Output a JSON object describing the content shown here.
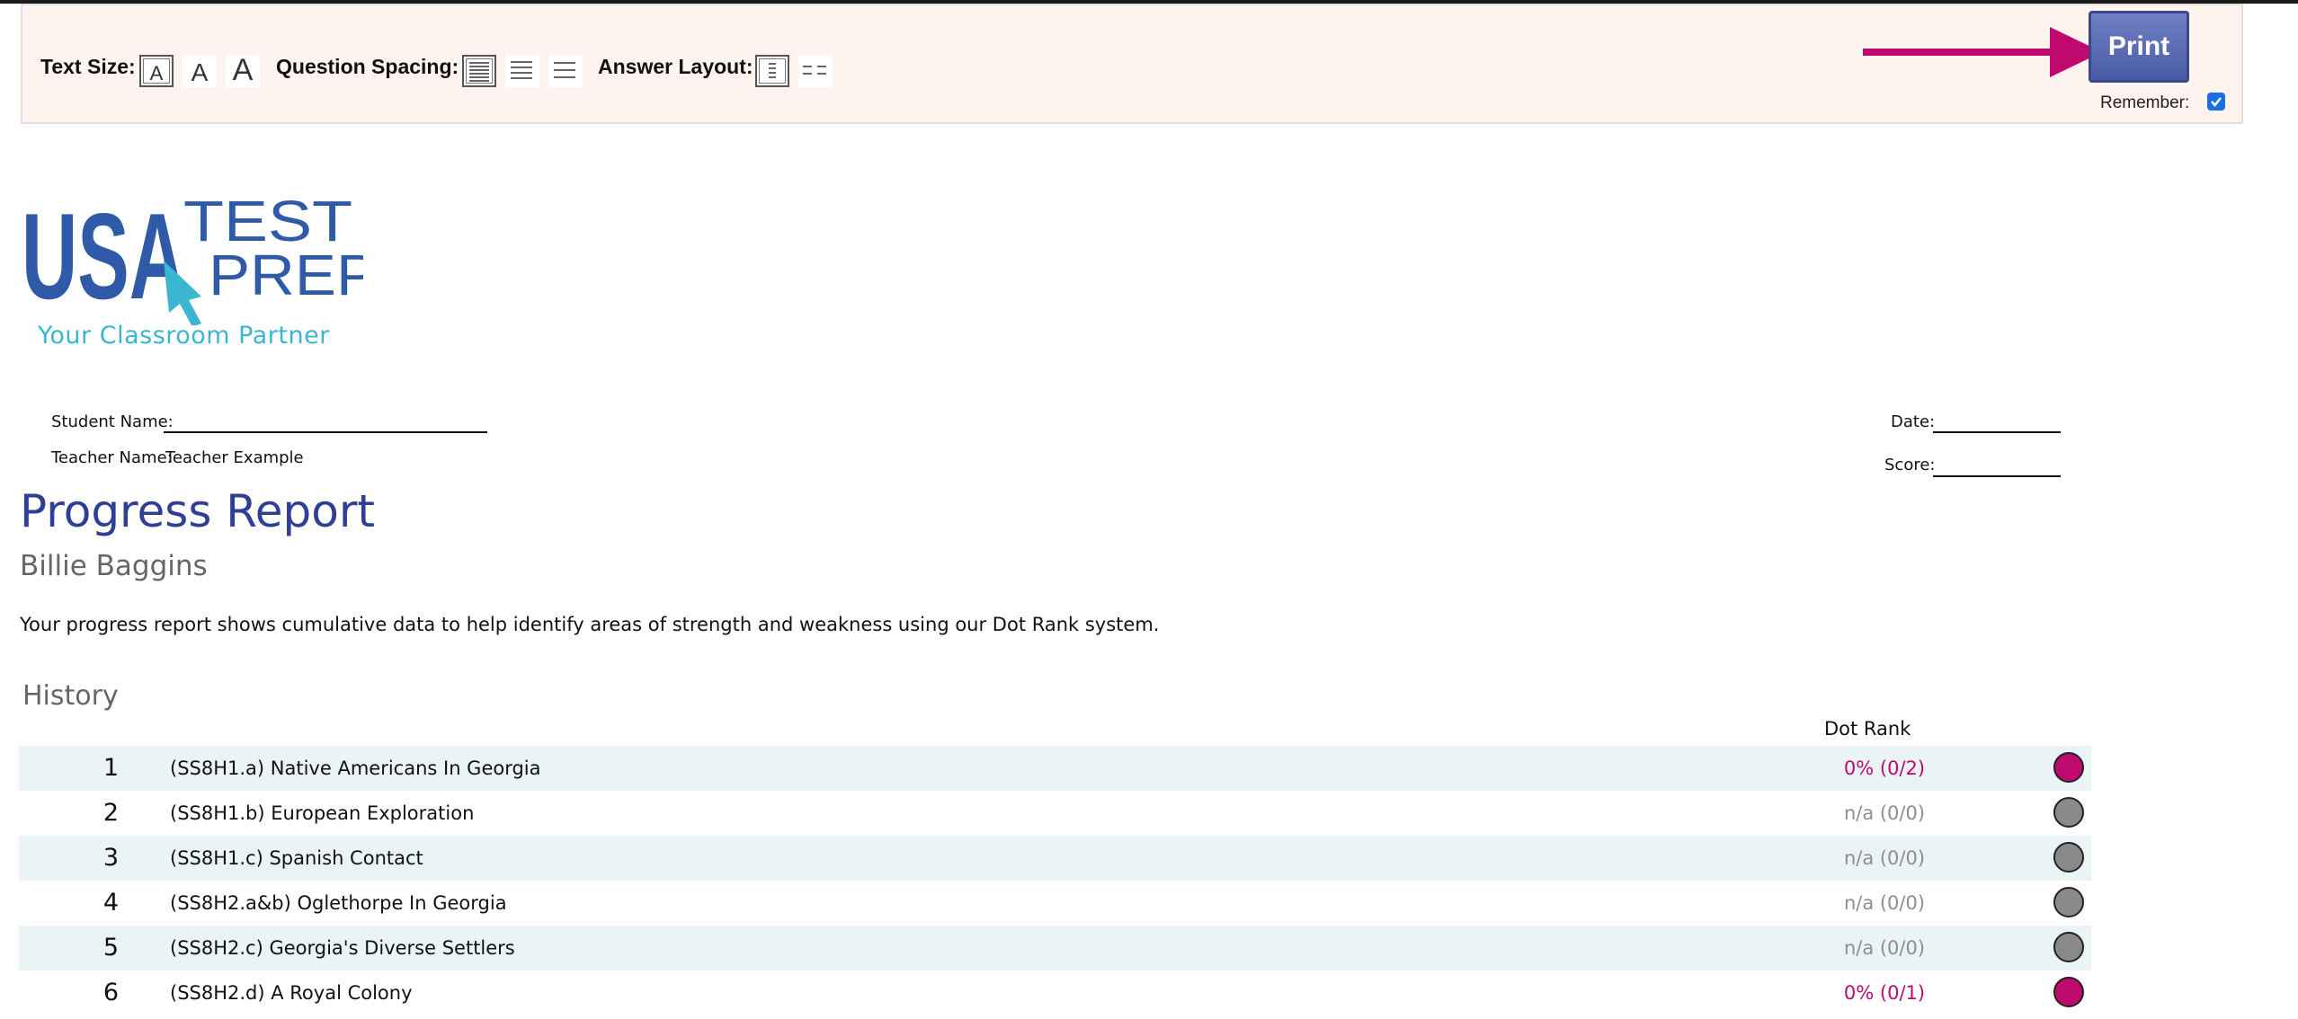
{
  "toolbar": {
    "text_size_label": "Text Size:",
    "question_spacing_label": "Question Spacing:",
    "answer_layout_label": "Answer Layout:",
    "size_glyph": "A",
    "print_label": "Print",
    "remember_label": "Remember:",
    "remember_checked": true
  },
  "logo": {
    "word_usa": "USA",
    "word_test": "TEST",
    "word_prep": "PREP",
    "tagline": "Your Classroom Partner"
  },
  "header": {
    "student_name_label": "Student Name:",
    "teacher_name_label": "Teacher Name:",
    "teacher_name": "Teacher Example",
    "date_label": "Date:",
    "score_label": "Score:"
  },
  "report": {
    "title": "Progress Report",
    "student": "Billie Baggins",
    "description": "Your progress report shows cumulative data to help identify areas of strength and weakness using our Dot Rank system.",
    "section": "History",
    "dot_rank_header": "Dot Rank",
    "rows": [
      {
        "num": "1",
        "name": "(SS8H1.a) Native Americans In Georgia",
        "score": "0% (0/2)",
        "status": "low"
      },
      {
        "num": "2",
        "name": "(SS8H1.b) European Exploration",
        "score": "n/a (0/0)",
        "status": "na"
      },
      {
        "num": "3",
        "name": "(SS8H1.c) Spanish Contact",
        "score": "n/a (0/0)",
        "status": "na"
      },
      {
        "num": "4",
        "name": "(SS8H2.a&b) Oglethorpe In Georgia",
        "score": "n/a (0/0)",
        "status": "na"
      },
      {
        "num": "5",
        "name": "(SS8H2.c) Georgia's Diverse Settlers",
        "score": "n/a (0/0)",
        "status": "na"
      },
      {
        "num": "6",
        "name": "(SS8H2.d) A Royal Colony",
        "score": "0% (0/1)",
        "status": "low"
      }
    ]
  },
  "colors": {
    "low": "#c0096f",
    "na": "#8a8a8a",
    "na_text": "#8e8e8e",
    "title": "#2f3e96",
    "arrow": "#c0096f",
    "logo_blue": "#2f5aa8",
    "logo_cyan": "#3bb6cf"
  }
}
